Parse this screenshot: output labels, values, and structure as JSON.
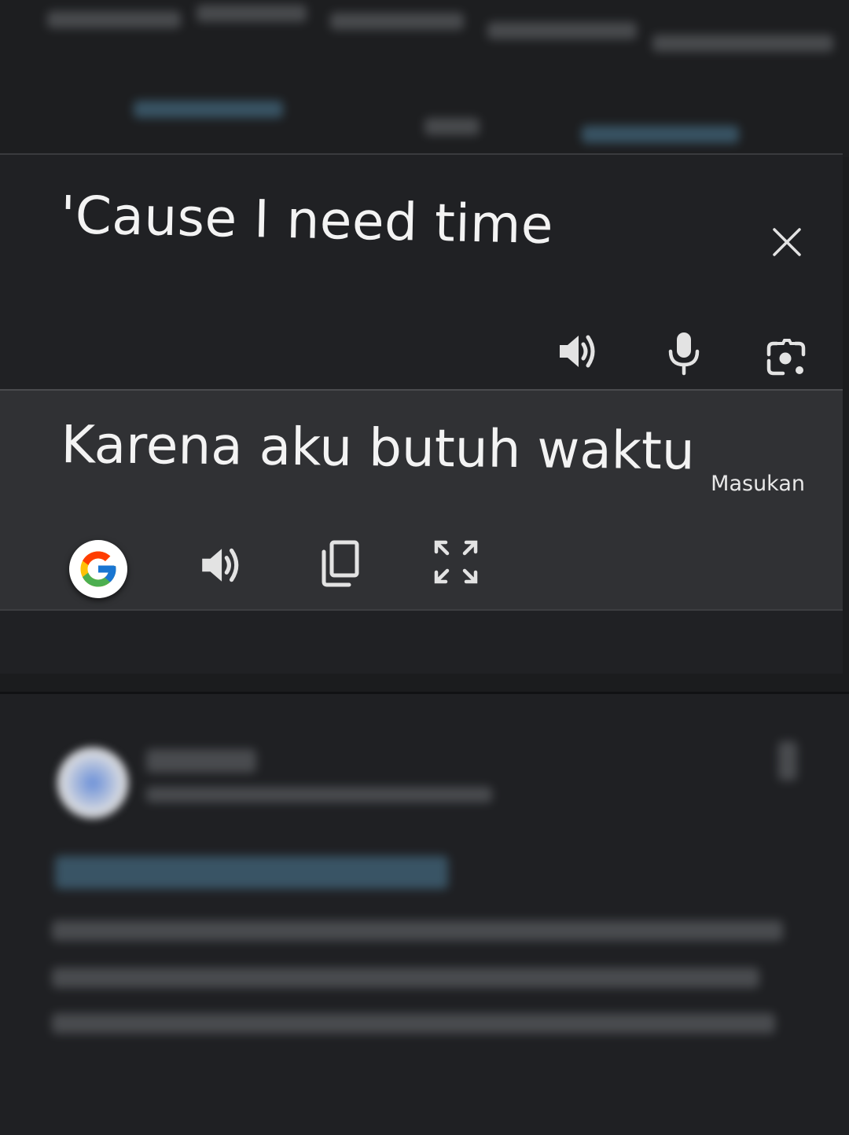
{
  "source": {
    "text": "'Cause I need time"
  },
  "translation": {
    "text": "Karena aku butuh waktu"
  },
  "feedback_label": "Masukan",
  "icons": {
    "close": "close-icon",
    "listen_source": "speaker-icon",
    "mic": "microphone-icon",
    "camera": "camera-lens-icon",
    "google": "google-logo-icon",
    "listen_translation": "speaker-icon",
    "copy": "copy-icon",
    "fullscreen": "fullscreen-icon"
  },
  "colors": {
    "background": "#1b1c1e",
    "card": "#202124",
    "result_panel": "#303134",
    "text": "#f3f3f3",
    "icon": "#e3e3e3"
  }
}
